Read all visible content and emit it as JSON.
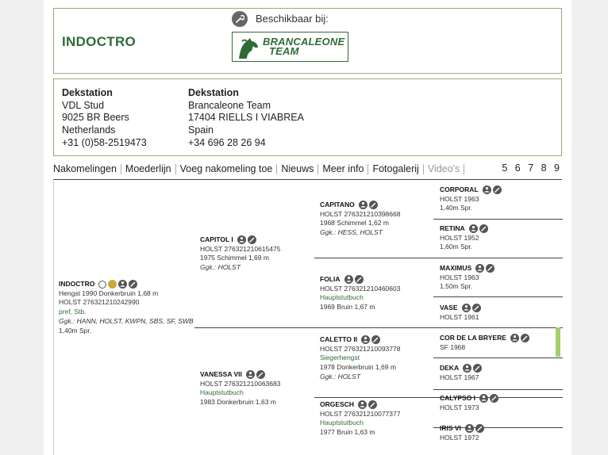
{
  "header": {
    "horse_name": "INDOCTRO",
    "available_label": "Beschikbaar bij:",
    "logo_text_1": "BRANCALEONE",
    "logo_text_2": "TEAM"
  },
  "stations": [
    {
      "title": "Dekstation",
      "lines": [
        "VDL Stud",
        "9025 BR Beers",
        "Netherlands",
        "+31 (0)58-2519473"
      ]
    },
    {
      "title": "Dekstation",
      "lines": [
        "Brancaleone Team",
        "17404 RIELLS I VIABREA",
        "Spain",
        "+34 696 28 26 94"
      ]
    }
  ],
  "tabs": [
    "Nakomelingen",
    "Moederlijn",
    "Voeg nakomeling toe",
    "Nieuws",
    "Meer info",
    "Fotogalerij",
    "Video's"
  ],
  "pages": "5 6 7 8 9",
  "pedigree": {
    "horse": {
      "name": "INDOCTRO",
      "l1": "Hengst 1990 Donkerbruin 1,68 m",
      "l2": "HOLST 276321210242990",
      "l3": "pref, Stb.",
      "l4": "Ggk.: HANN, HOLST, KWPN, SBS, SF, SWB",
      "l5": "1,40m Spr."
    },
    "sire": {
      "name": "CAPITOL I",
      "l1": "HOLST 276321210615475",
      "l2": "1975 Schimmel 1,69 m",
      "l3": "Ggk.: HOLST"
    },
    "dam": {
      "name": "VANESSA VII",
      "l1": "HOLST 276321210063683",
      "l2": "Hauptstutbuch",
      "l3": "1983 Donkerbruin 1,63 m"
    },
    "gp": [
      {
        "name": "CAPITANO",
        "l1": "HOLST 276321210398668",
        "l2": "1968 Schimmel 1,62 m",
        "l3": "Ggk.: HESS, HOLST"
      },
      {
        "name": "FOLIA",
        "l1": "HOLST 276321210460603",
        "l2": "Hauptstutbuch",
        "l3": "1969 Bruin 1,67 m"
      },
      {
        "name": "CALETTO II",
        "l1": "HOLST 276321210093778",
        "l2": "Siegerhengst",
        "l3": "1978 Donkerbruin 1,69 m",
        "l4": "Ggk.: HOLST"
      },
      {
        "name": "ORGESCH",
        "l1": "HOLST 276321210077377",
        "l2": "Hauptstutbuch",
        "l3": "1977 Bruin 1,63 m"
      }
    ],
    "ggp": [
      {
        "name": "CORPORAL",
        "l1": "HOLST 1963",
        "l2": "1,40m Spr."
      },
      {
        "name": "RETINA",
        "l1": "HOLST 1952",
        "l2": "1,60m Spr."
      },
      {
        "name": "MAXIMUS",
        "l1": "HOLST 1963",
        "l2": "1,50m Spr."
      },
      {
        "name": "VASE",
        "l1": "HOLST 1961"
      },
      {
        "name": "COR DE LA BRYERE",
        "l1": "SF 1968"
      },
      {
        "name": "DEKA",
        "l1": "HOLST 1967"
      },
      {
        "name": "CALYPSO I",
        "l1": "HOLST 1973"
      },
      {
        "name": "IRIS VI",
        "l1": "HOLST 1972"
      }
    ]
  },
  "colors": {
    "accent": "#2f6b37",
    "border": "#9aab78",
    "highlight_bar": "#a6cf6c"
  }
}
